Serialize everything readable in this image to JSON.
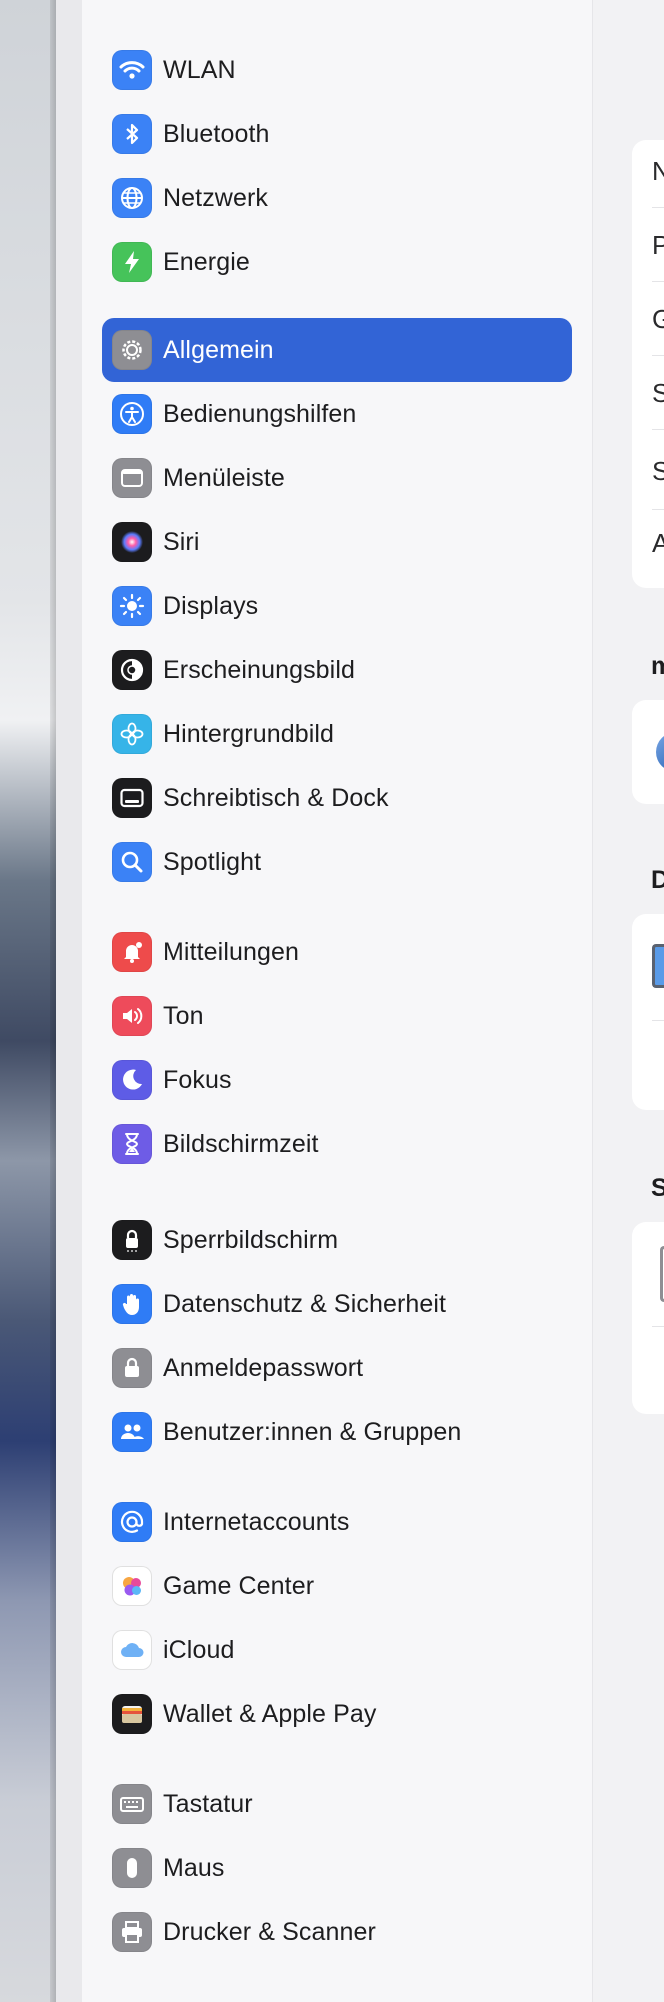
{
  "sidebar": {
    "groups": [
      [
        {
          "label": "WLAN",
          "icon": "wifi-icon",
          "color": "#3b82f6"
        },
        {
          "label": "Bluetooth",
          "icon": "bluetooth-icon",
          "color": "#3b82f6"
        },
        {
          "label": "Netzwerk",
          "icon": "globe-icon",
          "color": "#3b82f6"
        },
        {
          "label": "Energie",
          "icon": "bolt-icon",
          "color": "#46c35a"
        }
      ],
      [
        {
          "label": "Allgemein",
          "icon": "gear-icon",
          "color": "#8e8e93",
          "selected": true
        },
        {
          "label": "Bedienungshilfen",
          "icon": "accessibility-icon",
          "color": "#2f7cf6"
        },
        {
          "label": "Menüleiste",
          "icon": "menubar-icon",
          "color": "#8e8e93"
        },
        {
          "label": "Siri",
          "icon": "siri-icon",
          "color": "#1c1c1e"
        },
        {
          "label": "Displays",
          "icon": "sun-icon",
          "color": "#3b82f6"
        },
        {
          "label": "Erscheinungsbild",
          "icon": "appearance-icon",
          "color": "#1c1c1e"
        },
        {
          "label": "Hintergrundbild",
          "icon": "flower-icon",
          "color": "#36b4e8"
        },
        {
          "label": "Schreibtisch & Dock",
          "icon": "dock-icon",
          "color": "#1c1c1e"
        },
        {
          "label": "Spotlight",
          "icon": "magnifier-icon",
          "color": "#3b82f6"
        }
      ],
      [
        {
          "label": "Mitteilungen",
          "icon": "bell-icon",
          "color": "#ee4b4b"
        },
        {
          "label": "Ton",
          "icon": "speaker-icon",
          "color": "#ee4b5b"
        },
        {
          "label": "Fokus",
          "icon": "moon-icon",
          "color": "#5e5ce6"
        },
        {
          "label": "Bildschirmzeit",
          "icon": "hourglass-icon",
          "color": "#6e5ce6"
        }
      ],
      [
        {
          "label": "Sperrbildschirm",
          "icon": "lock-screen-icon",
          "color": "#1c1c1e"
        },
        {
          "label": "Datenschutz & Sicherheit",
          "icon": "hand-icon",
          "color": "#2f7cf6"
        },
        {
          "label": "Anmeldepasswort",
          "icon": "lock-icon",
          "color": "#8e8e93"
        },
        {
          "label": "Benutzer:innen & Gruppen",
          "icon": "users-icon",
          "color": "#2f7cf6"
        }
      ],
      [
        {
          "label": "Internetaccounts",
          "icon": "at-icon",
          "color": "#2f7cf6"
        },
        {
          "label": "Game Center",
          "icon": "game-center-icon",
          "color": "#ffffff"
        },
        {
          "label": "iCloud",
          "icon": "cloud-icon",
          "color": "#ffffff"
        },
        {
          "label": "Wallet & Apple Pay",
          "icon": "wallet-icon",
          "color": "#1c1c1e"
        }
      ],
      [
        {
          "label": "Tastatur",
          "icon": "keyboard-icon",
          "color": "#8e8e93"
        },
        {
          "label": "Maus",
          "icon": "mouse-icon",
          "color": "#8e8e93"
        },
        {
          "label": "Drucker & Scanner",
          "icon": "printer-icon",
          "color": "#8e8e93"
        }
      ]
    ]
  },
  "content": {
    "rows": [
      "N",
      "P",
      "G",
      "S",
      "S",
      "A"
    ],
    "sections": [
      "m",
      "D",
      "S"
    ]
  },
  "colors": {
    "accent": "#3264d6"
  }
}
